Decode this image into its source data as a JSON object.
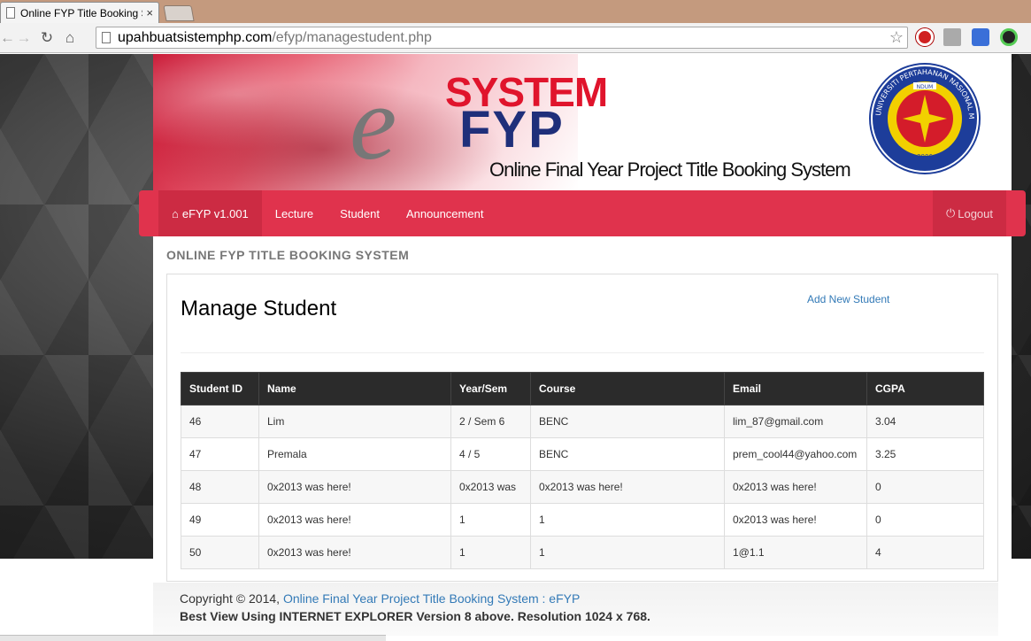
{
  "browser": {
    "tab_title": "Online FYP Title Booking System",
    "close_glyph": "×",
    "url_host": "upahbuatsistemphp.com",
    "url_path": "/efyp/managestudent.php"
  },
  "banner": {
    "logo_e": "e",
    "logo_system": "SYSTEM",
    "logo_fyp": "FYP",
    "tagline": "Online Final Year Project Title Booking System",
    "seal_top_text": "UNIVERSITI PERTAHANAN NASIONAL MALAYSIA",
    "seal_badge": "NDUM",
    "seal_year": "2006"
  },
  "nav": {
    "brand": "eFYP v1.001",
    "items": [
      "Lecture",
      "Student",
      "Announcement"
    ],
    "logout": "Logout"
  },
  "section_title": "ONLINE FYP TITLE BOOKING SYSTEM",
  "panel": {
    "heading": "Manage Student",
    "add_link": "Add New Student"
  },
  "table": {
    "headers": [
      "Student ID",
      "Name",
      "Year/Sem",
      "Course",
      "Email",
      "CGPA"
    ],
    "rows": [
      [
        "46",
        "Lim",
        "2 / Sem 6",
        "BENC",
        "lim_87@gmail.com",
        "3.04"
      ],
      [
        "47",
        "Premala",
        "4 / 5",
        "BENC",
        "prem_cool44@yahoo.com",
        "3.25"
      ],
      [
        "48",
        "0x2013 was here!",
        "0x2013 was",
        "0x2013 was here!",
        "0x2013 was here!",
        "0"
      ],
      [
        "49",
        "0x2013 was here!",
        "1",
        "1",
        "0x2013 was here!",
        "0"
      ],
      [
        "50",
        "0x2013 was here!",
        "1",
        "1",
        "1@1.1",
        "4"
      ]
    ]
  },
  "footer": {
    "copyright": "Copyright © 2014,",
    "link": "Online Final Year Project Title Booking System : eFYP",
    "note": "Best View Using INTERNET EXPLORER Version 8 above. Resolution 1024 x 768."
  },
  "colors": {
    "nav_red": "#e0334d",
    "nav_active": "#cc2b43",
    "table_header": "#2b2b2b",
    "link_blue": "#337ab7"
  }
}
